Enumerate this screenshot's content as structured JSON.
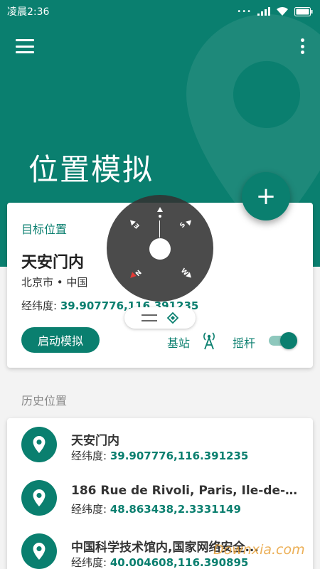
{
  "status_bar": {
    "time": "凌晨2:36"
  },
  "header": {
    "title": "位置模拟",
    "fab_label": "+"
  },
  "target": {
    "section_label": "目标位置",
    "name": "天安门内",
    "city": "北京市 • 中国",
    "coord_label": "经纬度:",
    "coord_value": "39.907776,116.391235",
    "start_button": "启动模拟",
    "base_station_label": "基站",
    "joystick_label": "摇杆",
    "joystick_enabled": true
  },
  "compass": {
    "letters": [
      "E",
      "S",
      "N",
      "W"
    ]
  },
  "history": {
    "title": "历史位置",
    "items": [
      {
        "name": "天安门内",
        "coord_label": "经纬度:",
        "coord_value": "39.907776,116.391235"
      },
      {
        "name": "186 Rue de Rivoli, Paris, Ile-de-Fr...",
        "coord_label": "经纬度:",
        "coord_value": "48.863438,2.3331149"
      },
      {
        "name": "中国科学技术馆内,国家网络安全...",
        "coord_label": "经纬度:",
        "coord_value": "40.004608,116.390895"
      }
    ]
  },
  "watermark": "Downxia.com",
  "colors": {
    "primary": "#0a7f6f",
    "toggle_track": "#8ec8bd"
  }
}
